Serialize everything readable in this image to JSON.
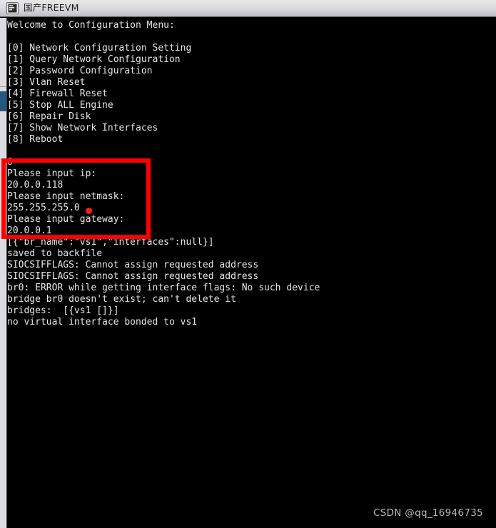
{
  "window": {
    "title": "国产FREEVM",
    "icon": "terminal-icon"
  },
  "terminal": {
    "background_color": "#000000",
    "text_color": "#e6e6e6",
    "lines": [
      {
        "text": "Welcome to Configuration Menu:"
      },
      {
        "text": ""
      },
      {
        "text": "[0] Network Configuration Setting"
      },
      {
        "text": "[1] Query Network Configuration"
      },
      {
        "text": "[2] Password Configuration"
      },
      {
        "text": "[3] Vlan Reset"
      },
      {
        "text": "[4] Firewall Reset"
      },
      {
        "text": "[5] Stop ALL Engine"
      },
      {
        "text": "[6] Repair Disk"
      },
      {
        "text": "[7] Show Network Interfaces"
      },
      {
        "text": "[8] Reboot"
      },
      {
        "text": ""
      },
      {
        "text": "0"
      },
      {
        "text": "Please input ip:"
      },
      {
        "text": "20.0.0.118"
      },
      {
        "text": "Please input netmask:"
      },
      {
        "text": "255.255.255.0"
      },
      {
        "text": "Please input gateway:"
      },
      {
        "text": "20.0.0.1"
      },
      {
        "text": "[{\"br_name\":\"vs1\",\"interfaces\":null}]"
      },
      {
        "text": "saved to backfile"
      },
      {
        "text": "SIOCSIFFLAGS: Cannot assign requested address"
      },
      {
        "text": "SIOCSIFFLAGS: Cannot assign requested address"
      },
      {
        "text": "br0: ERROR while getting interface flags: No such device"
      },
      {
        "text": "bridge br0 doesn't exist; can't delete it"
      },
      {
        "text": "bridges:  [{vs1 []}]"
      },
      {
        "text": "no virtual interface bonded to vs1"
      }
    ]
  },
  "scrollbar": {
    "track_color": "#dcdce0",
    "thumb_color": "#24587f"
  },
  "annotation": {
    "box_color": "#ff0000",
    "dot_color": "#ff1a1a"
  },
  "watermark": {
    "text": "CSDN @qq_16946735"
  }
}
